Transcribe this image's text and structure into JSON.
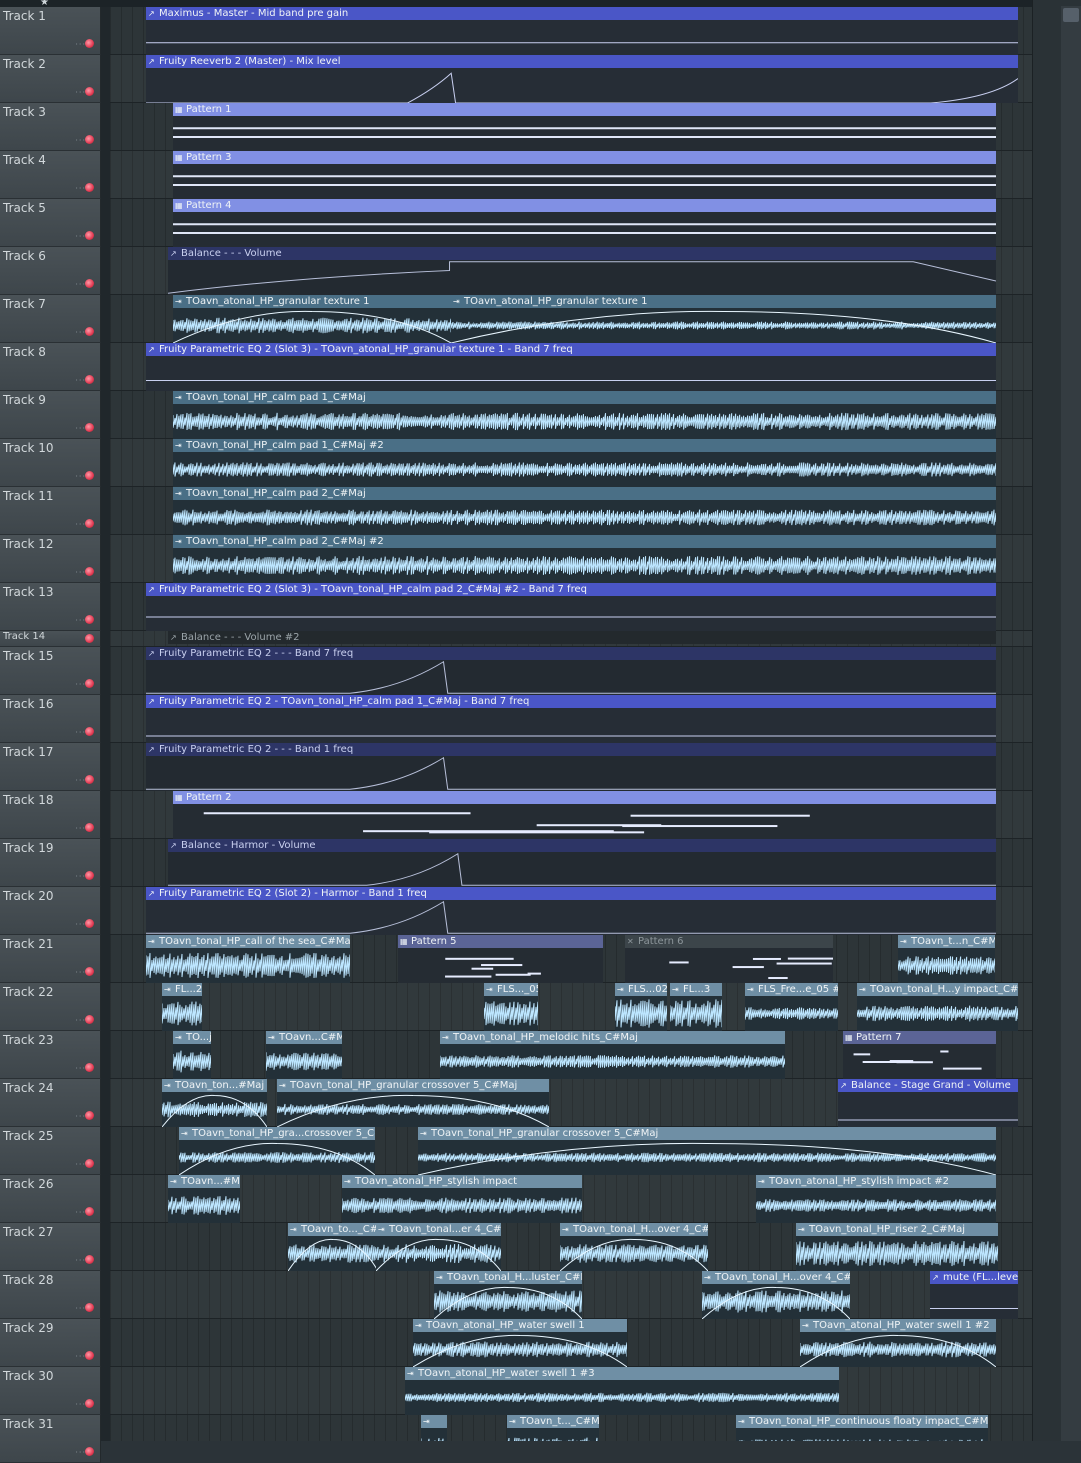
{
  "tracks": [
    "Track 1",
    "Track 2",
    "Track 3",
    "Track 4",
    "Track 5",
    "Track 6",
    "Track 7",
    "Track 8",
    "Track 9",
    "Track 10",
    "Track 11",
    "Track 12",
    "Track 13",
    "Track 14",
    "Track 15",
    "Track 16",
    "Track 17",
    "Track 18",
    "Track 19",
    "Track 20",
    "Track 21",
    "Track 22",
    "Track 23",
    "Track 24",
    "Track 25",
    "Track 26",
    "Track 27",
    "Track 28",
    "Track 29",
    "Track 30",
    "Track 31"
  ],
  "clips": [
    {
      "track": 1,
      "kind": "automation",
      "label": "Maximus - Master - Mid band pre gain"
    },
    {
      "track": 2,
      "kind": "automation",
      "label": "Fruity Reeverb 2 (Master) - Mix level"
    },
    {
      "track": 3,
      "kind": "pattern",
      "label": "Pattern 1"
    },
    {
      "track": 4,
      "kind": "pattern",
      "label": "Pattern 3"
    },
    {
      "track": 5,
      "kind": "pattern",
      "label": "Pattern 4"
    },
    {
      "track": 6,
      "kind": "automation",
      "label": "Balance - - - Volume"
    },
    {
      "track": 7,
      "kind": "audio",
      "label": "TOavn_atonal_HP_granular texture 1"
    },
    {
      "track": 7,
      "kind": "audio",
      "label": "TOavn_atonal_HP_granular texture 1"
    },
    {
      "track": 8,
      "kind": "automation",
      "label": "Fruity Parametric EQ 2 (Slot 3) - TOavn_atonal_HP_granular texture 1 - Band 7 freq"
    },
    {
      "track": 9,
      "kind": "audio",
      "label": "TOavn_tonal_HP_calm pad 1_C#Maj"
    },
    {
      "track": 10,
      "kind": "audio",
      "label": "TOavn_tonal_HP_calm pad 1_C#Maj #2"
    },
    {
      "track": 11,
      "kind": "audio",
      "label": "TOavn_tonal_HP_calm pad 2_C#Maj"
    },
    {
      "track": 12,
      "kind": "audio",
      "label": "TOavn_tonal_HP_calm pad 2_C#Maj #2"
    },
    {
      "track": 13,
      "kind": "automation",
      "label": "Fruity Parametric EQ 2 (Slot 3) - TOavn_tonal_HP_calm pad 2_C#Maj #2 - Band 7 freq"
    },
    {
      "track": 14,
      "kind": "automation",
      "label": "Balance - - - Volume #2"
    },
    {
      "track": 15,
      "kind": "automation",
      "label": "Fruity Parametric EQ 2 - - - Band 7 freq"
    },
    {
      "track": 16,
      "kind": "automation",
      "label": "Fruity Parametric EQ 2 - TOavn_tonal_HP_calm pad 1_C#Maj - Band 7 freq"
    },
    {
      "track": 17,
      "kind": "automation",
      "label": "Fruity Parametric EQ 2 - - - Band 1 freq"
    },
    {
      "track": 18,
      "kind": "pattern",
      "label": "Pattern 2"
    },
    {
      "track": 19,
      "kind": "automation",
      "label": "Balance - Harmor - Volume"
    },
    {
      "track": 20,
      "kind": "automation",
      "label": "Fruity Parametric EQ 2 (Slot 2) - Harmor - Band 1 freq"
    },
    {
      "track": 21,
      "kind": "audio",
      "label": "TOavn_tonal_HP_call of the sea_C#Maj"
    },
    {
      "track": 21,
      "kind": "pattern",
      "label": "Pattern 5"
    },
    {
      "track": 21,
      "kind": "pattern",
      "label": "Pattern 6"
    },
    {
      "track": 21,
      "kind": "audio",
      "label": "TOavn_t...n_C#Maj"
    },
    {
      "track": 22,
      "kind": "audio",
      "label": "FL...2"
    },
    {
      "track": 22,
      "kind": "audio",
      "label": "FLS..._05"
    },
    {
      "track": 22,
      "kind": "audio",
      "label": "FLS...02"
    },
    {
      "track": 22,
      "kind": "audio",
      "label": "FL...3"
    },
    {
      "track": 22,
      "kind": "audio",
      "label": "FLS_Fre...e_05 #3"
    },
    {
      "track": 22,
      "kind": "audio",
      "label": "TOavn_tonal_H...y impact_C#Maj"
    },
    {
      "track": 23,
      "kind": "audio",
      "label": "TO...j"
    },
    {
      "track": 23,
      "kind": "audio",
      "label": "TOavn...C#Maj"
    },
    {
      "track": 23,
      "kind": "audio",
      "label": "TOavn_tonal_HP_melodic hits_C#Maj"
    },
    {
      "track": 23,
      "kind": "pattern",
      "label": "Pattern 7"
    },
    {
      "track": 24,
      "kind": "audio",
      "label": "TOavn_ton...#Maj #2"
    },
    {
      "track": 24,
      "kind": "audio",
      "label": "TOavn_tonal_HP_granular crossover 5_C#Maj"
    },
    {
      "track": 24,
      "kind": "automation",
      "label": "Balance - Stage Grand - Volume"
    },
    {
      "track": 25,
      "kind": "audio",
      "label": "TOavn_tonal_HP_gra...crossover 5_C#Maj"
    },
    {
      "track": 25,
      "kind": "audio",
      "label": "TOavn_tonal_HP_granular crossover 5_C#Maj"
    },
    {
      "track": 26,
      "kind": "audio",
      "label": "TOavn...#Maj"
    },
    {
      "track": 26,
      "kind": "audio",
      "label": "TOavn_atonal_HP_stylish impact"
    },
    {
      "track": 26,
      "kind": "audio",
      "label": "TOavn_atonal_HP_stylish impact #2"
    },
    {
      "track": 27,
      "kind": "audio",
      "label": "TOavn_to..._C#M"
    },
    {
      "track": 27,
      "kind": "audio",
      "label": "TOavn_tonal...er 4_C#Maj"
    },
    {
      "track": 27,
      "kind": "audio",
      "label": "TOavn_tonal_H...over 4_C#Maj"
    },
    {
      "track": 27,
      "kind": "audio",
      "label": "TOavn_tonal_HP_riser 2_C#Maj"
    },
    {
      "track": 28,
      "kind": "audio",
      "label": "TOavn_tonal_H...luster_C#Maj"
    },
    {
      "track": 28,
      "kind": "audio",
      "label": "TOavn_tonal_H...over 4_C#Maj"
    },
    {
      "track": 28,
      "kind": "automation",
      "label": "mute (FL...level"
    },
    {
      "track": 29,
      "kind": "audio",
      "label": "TOavn_atonal_HP_water swell 1"
    },
    {
      "track": 29,
      "kind": "audio",
      "label": "TOavn_atonal_HP_water swell 1 #2"
    },
    {
      "track": 30,
      "kind": "audio",
      "label": "TOavn_atonal_HP_water swell 1 #3"
    },
    {
      "track": 31,
      "kind": "audio",
      "label": ""
    },
    {
      "track": 31,
      "kind": "audio",
      "label": "TOavn_t..._C#Maj"
    },
    {
      "track": 31,
      "kind": "audio",
      "label": "TOavn_tonal_HP_continuous floaty impact_C#Maj"
    }
  ],
  "icons": {
    "automation": "automation-curve-icon",
    "pattern": "pattern-icon",
    "audio": "audio-clip-icon",
    "muted": "muted-x-icon",
    "record": "record-icon"
  },
  "colors": {
    "automation": "#4a56c7",
    "pattern": "#8190e4",
    "audio": "#4a6f86",
    "waveform": "#bde6ff",
    "record": "#e23a52",
    "background": "#2b3338"
  }
}
